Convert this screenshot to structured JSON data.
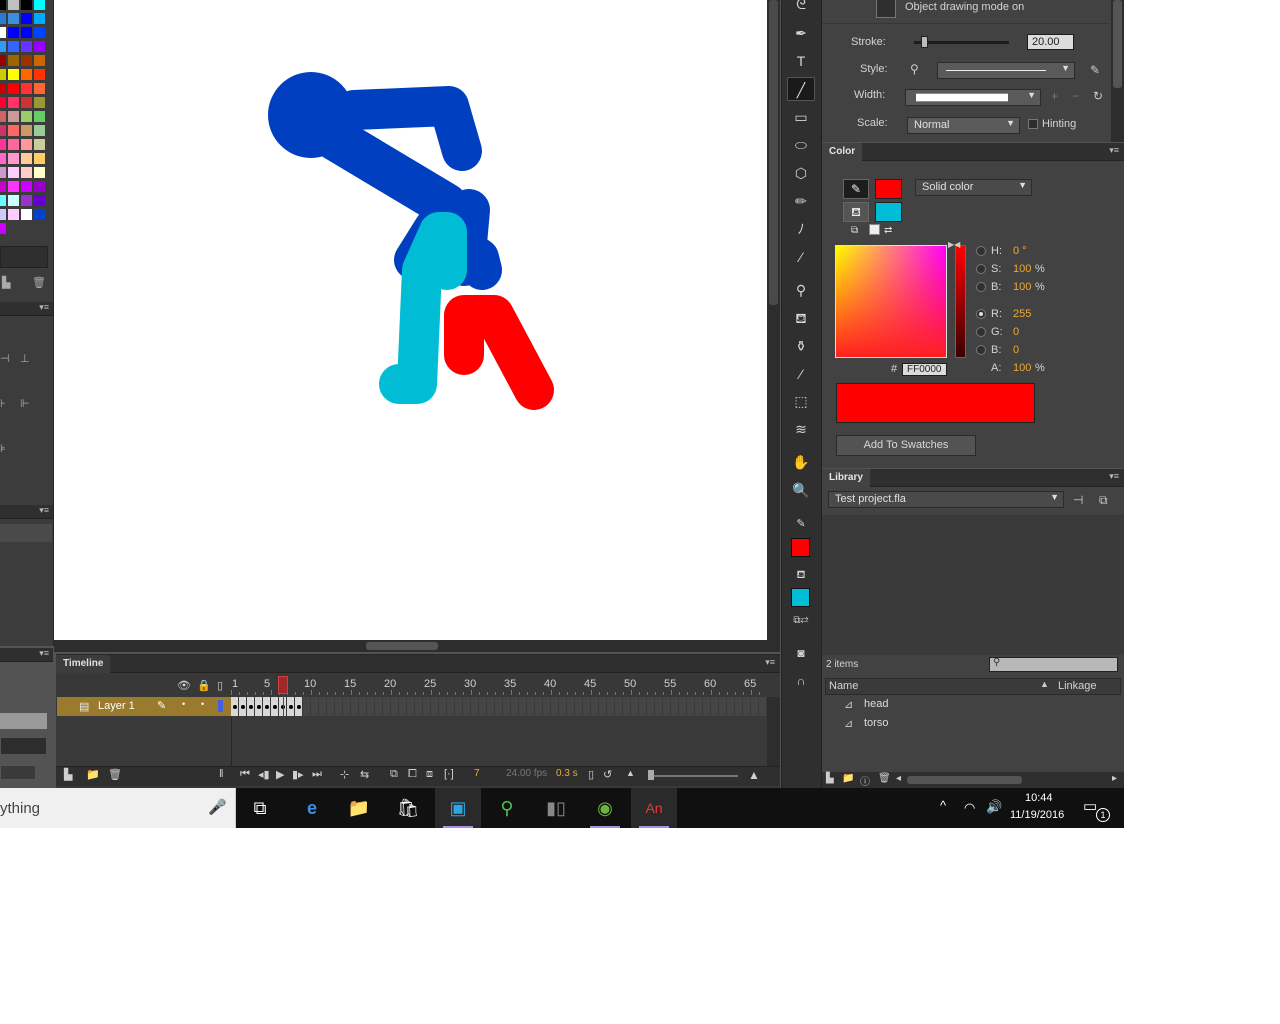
{
  "properties": {
    "drawing_mode": "Object drawing mode on",
    "stroke_label": "Stroke:",
    "stroke_value": "20.00",
    "stroke_level": 0.1,
    "style_label": "Style:",
    "width_label": "Width:",
    "scale_label": "Scale:",
    "scale_value": "Normal",
    "hinting_label": "Hinting"
  },
  "color_panel": {
    "tab": "Color",
    "fill_type": "Solid color",
    "stroke_color": "#ff0000",
    "fill_color": "#00bcd4",
    "h_label": "H:",
    "h_value": "0 °",
    "s_label": "S:",
    "s_value": "100",
    "s_unit": "%",
    "b_label": "B:",
    "b_value": "100",
    "b_unit": "%",
    "r_label": "R:",
    "r_value": "255",
    "g_label": "G:",
    "g_value": "0",
    "bl_label": "B:",
    "bl_value": "0",
    "a_label": "A:",
    "a_value": "100",
    "a_unit": "%",
    "hex_prefix": "#",
    "hex_value": "FF0000",
    "add_swatches": "Add To Swatches"
  },
  "library": {
    "tab": "Library",
    "document": "Test project.fla",
    "count": "2 items",
    "col_name": "Name",
    "col_linkage": "Linkage",
    "items": [
      {
        "name": "head"
      },
      {
        "name": "torso"
      }
    ]
  },
  "timeline": {
    "tab": "Timeline",
    "layer_name": "Layer 1",
    "ruler_ticks": [
      "1",
      "5",
      "10",
      "15",
      "20",
      "25",
      "30",
      "35",
      "40",
      "45",
      "50",
      "55",
      "60",
      "65"
    ],
    "current_frame": "7",
    "fps": "24.00 fps",
    "time": "0.3 s",
    "frame_count": 9
  },
  "taskbar": {
    "search_partial": "ything",
    "time": "10:44",
    "date": "11/19/2016",
    "notifications": "1"
  },
  "colors": {
    "blue": "#0040c0",
    "cyan": "#00bcd4",
    "red": "#ff0000",
    "panel": "#424242",
    "accent_orange": "#f0a830"
  }
}
